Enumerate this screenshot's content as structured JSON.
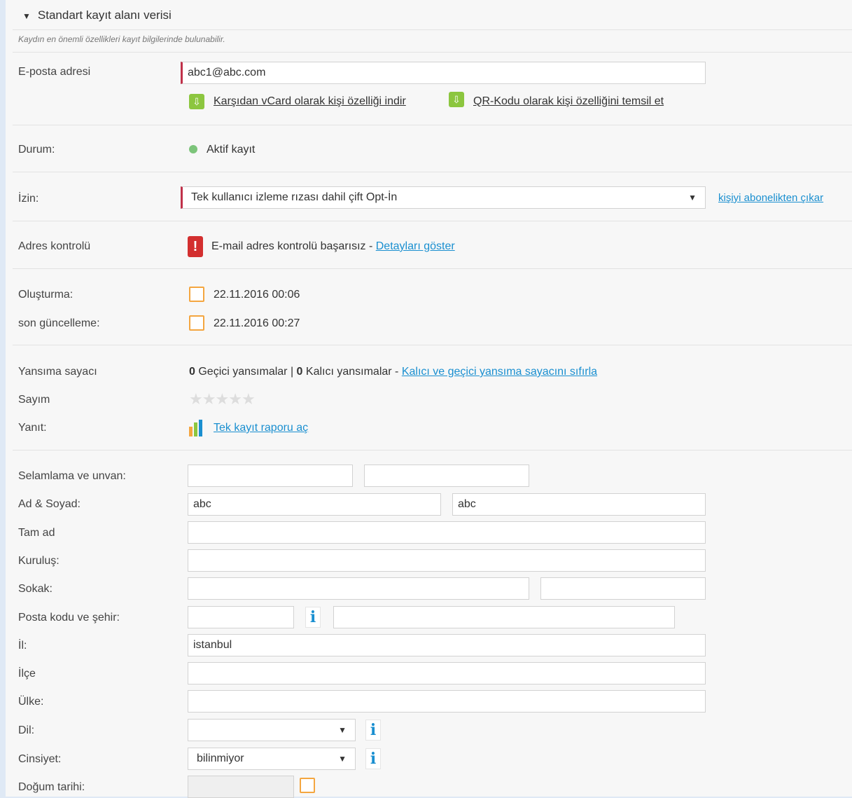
{
  "section": {
    "title": "Standart kayıt alanı verisi",
    "subtitle": "Kaydın en önemli özellikleri kayıt bilgilerinde bulunabilir."
  },
  "email": {
    "label": "E-posta adresi",
    "value": "abc1@abc.com",
    "vcard_link": "Karşıdan vCard olarak kişi özelliği indir",
    "qr_link": "QR-Kodu olarak kişi özelliğini temsil et"
  },
  "status": {
    "label": "Durum:",
    "value": "Aktif kayıt",
    "color": "#7cc47a"
  },
  "permission": {
    "label": "İzin:",
    "selected": "Tek kullanıcı izleme rızası dahil çift Opt-İn",
    "unsubscribe_link": "kişiyi abonelikten çıkar"
  },
  "address_check": {
    "label": "Adres kontrolü",
    "text": "E-mail adres kontrolü başarısız - ",
    "details_link": "Detayları göster"
  },
  "dates": {
    "created_label": "Oluşturma:",
    "created_value": "22.11.2016 00:06",
    "updated_label": "son güncelleme:",
    "updated_value": "22.11.2016 00:27"
  },
  "bounce": {
    "label": "Yansıma sayacı",
    "soft_count": "0",
    "soft_text": " Geçici yansımalar | ",
    "hard_count": "0",
    "hard_text": " Kalıcı yansımalar - ",
    "reset_link": "Kalıcı ve geçici yansıma sayacını sıfırla"
  },
  "rating": {
    "label": "Sayım",
    "stars": 0,
    "max": 5
  },
  "response": {
    "label": "Yanıt:",
    "report_link": "Tek kayıt raporu aç"
  },
  "form": {
    "salutation_label": "Selamlama ve unvan:",
    "salutation_value": "",
    "title_value": "",
    "name_label": "Ad & Soyad:",
    "first_name": "abc",
    "last_name": "abc",
    "fullname_label": "Tam ad",
    "fullname_value": "",
    "org_label": "Kuruluş:",
    "org_value": "",
    "street_label": "Sokak:",
    "street_value": "",
    "street_no_value": "",
    "zip_label": "Posta kodu ve şehir:",
    "zip_value": "",
    "city_value": "",
    "province_label": "İl:",
    "province_value": "istanbul",
    "district_label": "İlçe",
    "district_value": "",
    "country_label": "Ülke:",
    "country_value": "",
    "language_label": "Dil:",
    "language_value": "",
    "gender_label": "Cinsiyet:",
    "gender_value": "bilinmiyor",
    "birthday_label": "Doğum tarihi:",
    "birthday_value": ""
  },
  "icons": {
    "download": "download-icon",
    "calendar": "calendar-icon",
    "info": "info-icon",
    "error": "error-icon",
    "chart": "chart-icon"
  }
}
